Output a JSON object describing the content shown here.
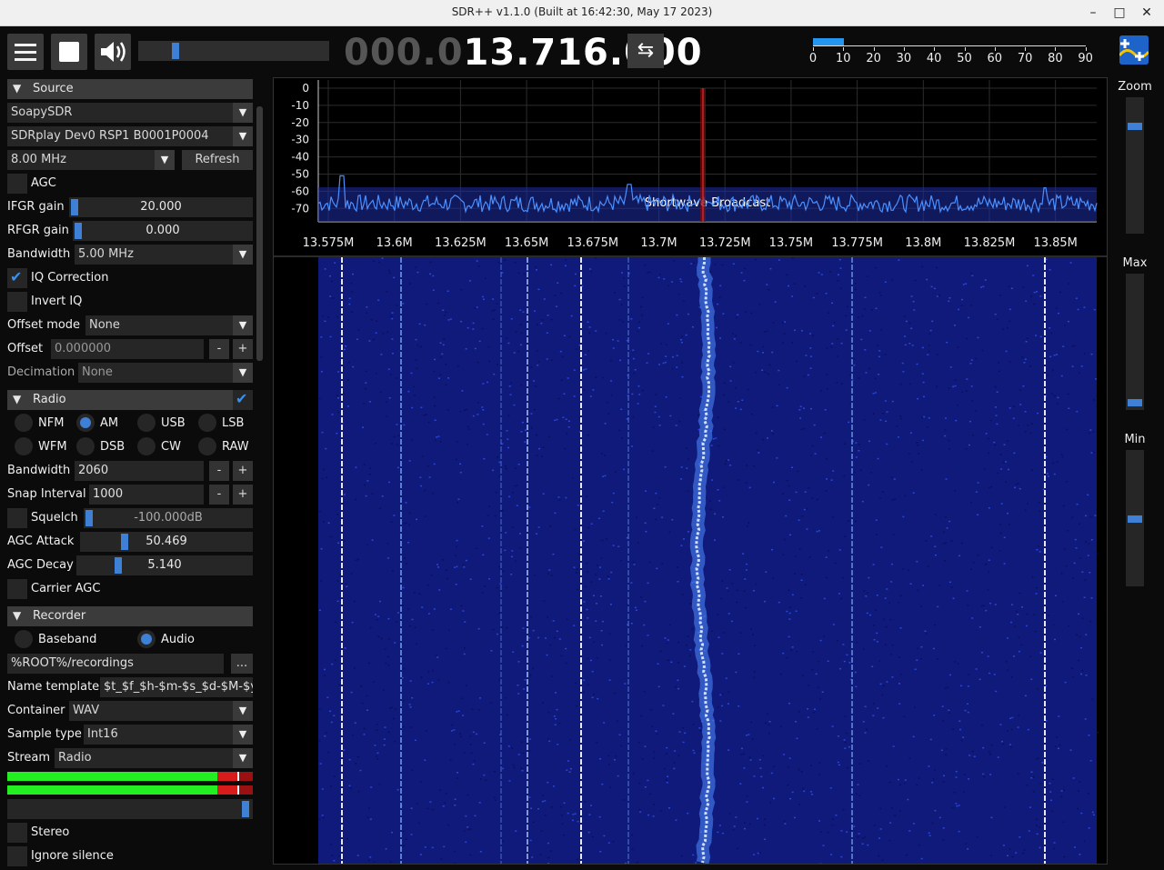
{
  "window": {
    "title": "SDR++ v1.1.0 (Built at 16:42:30, May 17 2023)",
    "minimize": "–",
    "maximize": "□",
    "close": "✕"
  },
  "toolbar": {
    "frequency_dim": "000.0",
    "frequency_bright": "13.716.000",
    "volume": 0.2,
    "snr_value": 10,
    "snr_scale": [
      "0",
      "10",
      "20",
      "30",
      "40",
      "50",
      "60",
      "70",
      "80",
      "90"
    ],
    "swap_icon": "⇆"
  },
  "source": {
    "header": "Source",
    "type": "SoapySDR",
    "device": "SDRplay Dev0 RSP1 B0001P0004",
    "samplerate": "8.00 MHz",
    "refresh": "Refresh",
    "agc_label": "AGC",
    "ifgr_label": "IFGR gain",
    "ifgr_value": "20.000",
    "rfgr_label": "RFGR gain",
    "rfgr_value": "0.000",
    "bandwidth_label": "Bandwidth",
    "bandwidth_value": "5.00 MHz",
    "iq_correction": "IQ Correction",
    "invert_iq": "Invert IQ",
    "offset_mode_label": "Offset mode",
    "offset_mode_value": "None",
    "offset_label": "Offset",
    "offset_value": "0.000000",
    "decimation_label": "Decimation",
    "decimation_value": "None"
  },
  "radio": {
    "header": "Radio",
    "modes": [
      "NFM",
      "AM",
      "USB",
      "LSB",
      "WFM",
      "DSB",
      "CW",
      "RAW"
    ],
    "selected_mode": "AM",
    "bandwidth_label": "Bandwidth",
    "bandwidth_value": "2060",
    "snap_label": "Snap Interval",
    "snap_value": "1000",
    "squelch_label": "Squelch",
    "squelch_value": "-100.000dB",
    "agc_attack_label": "AGC Attack",
    "agc_attack_value": "50.469",
    "agc_decay_label": "AGC Decay",
    "agc_decay_value": "5.140",
    "carrier_agc": "Carrier AGC",
    "minus": "-",
    "plus": "+"
  },
  "recorder": {
    "header": "Recorder",
    "baseband": "Baseband",
    "audio": "Audio",
    "path": "%ROOT%/recordings",
    "browse": "...",
    "name_template_label": "Name template",
    "name_template_value": "$t_$f_$h-$m-$s_$d-$M-$y",
    "container_label": "Container",
    "container_value": "WAV",
    "sample_type_label": "Sample type",
    "sample_type_value": "Int16",
    "stream_label": "Stream",
    "stream_value": "Radio",
    "stereo": "Stereo",
    "ignore_silence": "Ignore silence"
  },
  "fft": {
    "db_labels": [
      "0",
      "-10",
      "-20",
      "-30",
      "-40",
      "-50",
      "-60",
      "-70"
    ],
    "freq_labels": [
      "13.575M",
      "13.6M",
      "13.625M",
      "13.65M",
      "13.675M",
      "13.7M",
      "13.725M",
      "13.75M",
      "13.775M",
      "13.8M",
      "13.825M",
      "13.85M"
    ],
    "band_label": "Shortwave Broadcast"
  },
  "side": {
    "zoom": "Zoom",
    "max": "Max",
    "min": "Min"
  }
}
